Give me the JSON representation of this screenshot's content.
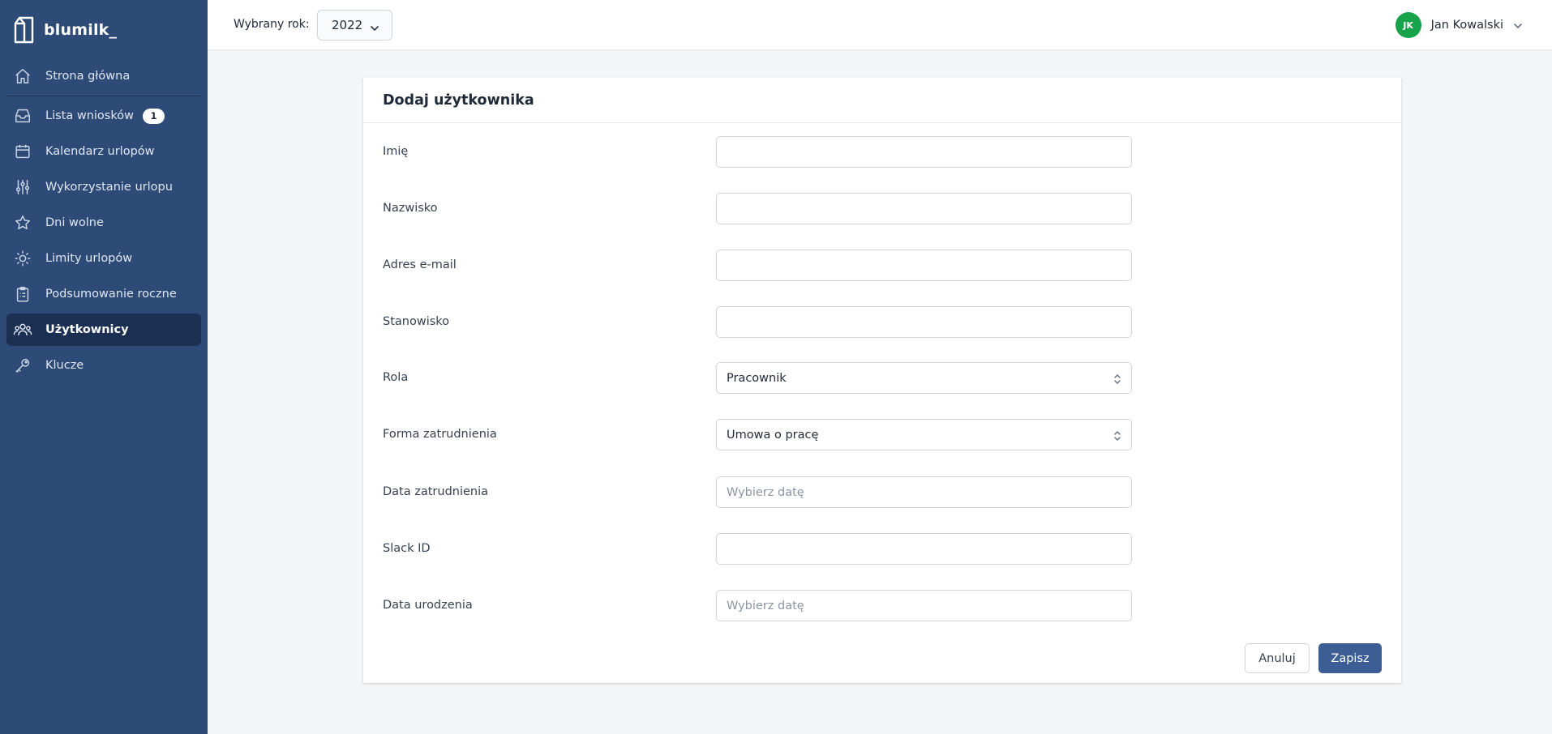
{
  "brand": {
    "name": "blumilk_"
  },
  "sidebar": {
    "items": [
      {
        "label": "Strona główna",
        "icon": "home-icon"
      },
      {
        "label": "Lista wniosków",
        "icon": "inbox-icon",
        "badge": "1"
      },
      {
        "label": "Kalendarz urlopów",
        "icon": "calendar-icon"
      },
      {
        "label": "Wykorzystanie urlopu",
        "icon": "sliders-icon"
      },
      {
        "label": "Dni wolne",
        "icon": "star-icon"
      },
      {
        "label": "Limity urlopów",
        "icon": "sun-icon"
      },
      {
        "label": "Podsumowanie roczne",
        "icon": "clipboard-icon"
      },
      {
        "label": "Użytkownicy",
        "icon": "users-icon",
        "active": true
      },
      {
        "label": "Klucze",
        "icon": "key-icon"
      }
    ]
  },
  "topbar": {
    "year_label": "Wybrany rok:",
    "year_value": "2022",
    "user_initials": "JK",
    "user_name": "Jan Kowalski"
  },
  "form": {
    "title": "Dodaj użytkownika",
    "fields": [
      {
        "label": "Imię",
        "value": ""
      },
      {
        "label": "Nazwisko",
        "value": ""
      },
      {
        "label": "Adres e-mail",
        "value": ""
      },
      {
        "label": "Stanowisko",
        "value": ""
      },
      {
        "label": "Rola",
        "value": "Pracownik"
      },
      {
        "label": "Forma zatrudnienia",
        "value": "Umowa o pracę"
      },
      {
        "label": "Data zatrudnienia",
        "placeholder": "Wybierz datę"
      },
      {
        "label": "Slack ID",
        "value": ""
      },
      {
        "label": "Data urodzenia",
        "placeholder": "Wybierz datę"
      }
    ],
    "cancel_label": "Anuluj",
    "save_label": "Zapisz"
  },
  "colors": {
    "sidebar_bg": "#2e4a77",
    "sidebar_active_bg": "#1a2f51",
    "primary_button": "#3d5e94",
    "avatar_bg": "#16a34a"
  }
}
